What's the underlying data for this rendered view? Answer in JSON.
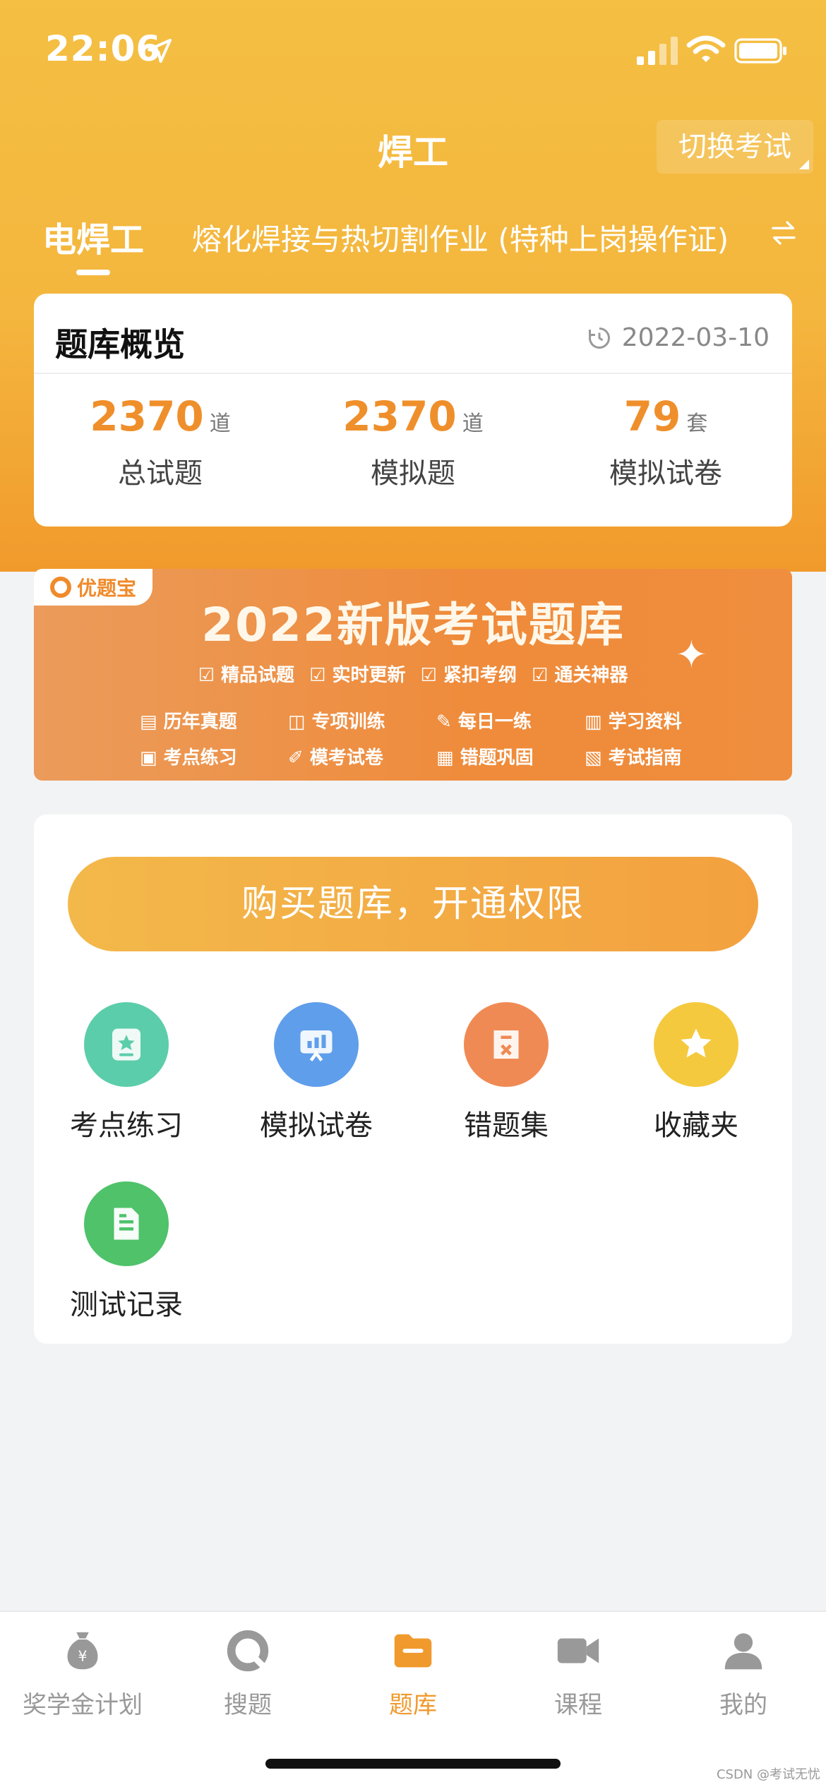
{
  "status_bar": {
    "time": "22:06"
  },
  "header": {
    "title": "焊工",
    "switch_label": "切换考试",
    "tab_active": "电焊工",
    "tab_sub": "熔化焊接与热切割作业 (特种上岗操作证)"
  },
  "overview": {
    "title": "题库概览",
    "date": "2022-03-10",
    "stats": [
      {
        "value": "2370",
        "unit": "道",
        "label": "总试题"
      },
      {
        "value": "2370",
        "unit": "道",
        "label": "模拟题"
      },
      {
        "value": "79",
        "unit": "套",
        "label": "模拟试卷"
      }
    ]
  },
  "banner": {
    "brand": "优题宝",
    "headline": "2022新版考试题库",
    "tags": [
      "精品试题",
      "实时更新",
      "紧扣考纲",
      "通关神器"
    ],
    "features": [
      "历年真题",
      "专项训练",
      "每日一练",
      "学习资料",
      "考点练习",
      "模考试卷",
      "错题巩固",
      "考试指南"
    ]
  },
  "tools": {
    "buy_label": "购买题库，开通权限",
    "items": [
      {
        "label": "考点练习",
        "icon": "star-card-icon",
        "color": "#5ccdaa"
      },
      {
        "label": "模拟试卷",
        "icon": "chart-board-icon",
        "color": "#5f9eea"
      },
      {
        "label": "错题集",
        "icon": "error-file-icon",
        "color": "#f08a54"
      },
      {
        "label": "收藏夹",
        "icon": "star-icon",
        "color": "#f5c93d"
      },
      {
        "label": "测试记录",
        "icon": "document-icon",
        "color": "#4fc26a"
      }
    ]
  },
  "tabbar": {
    "items": [
      {
        "label": "奖学金计划",
        "icon": "money-bag-icon"
      },
      {
        "label": "搜题",
        "icon": "search-icon"
      },
      {
        "label": "题库",
        "icon": "folder-icon",
        "active": true
      },
      {
        "label": "课程",
        "icon": "video-camera-icon"
      },
      {
        "label": "我的",
        "icon": "person-icon"
      }
    ],
    "active_color": "#f09a2d"
  },
  "watermark": "CSDN @考试无忧"
}
